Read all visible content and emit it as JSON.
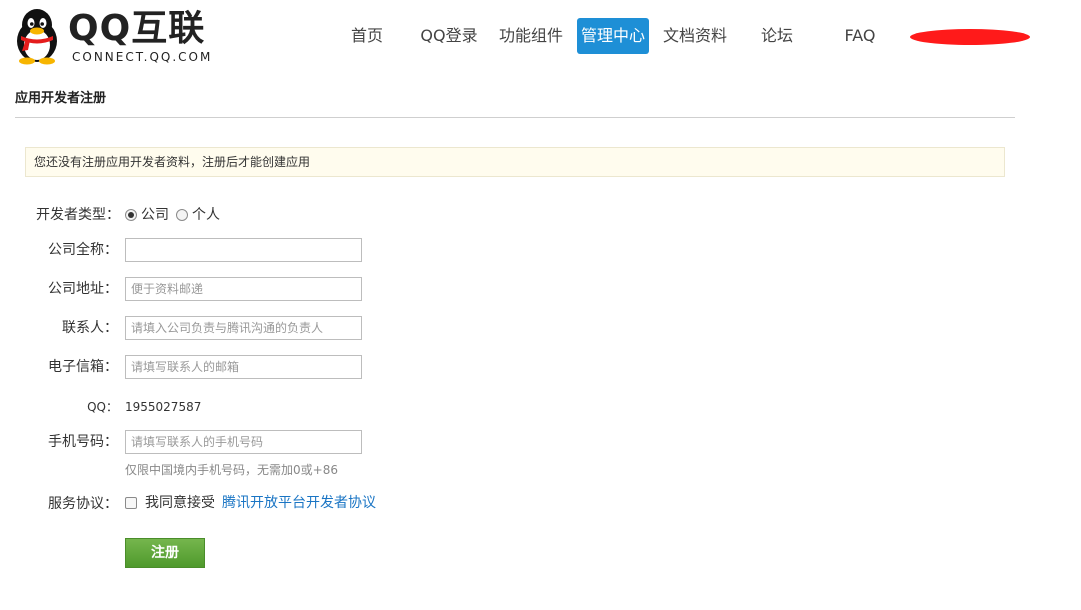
{
  "header": {
    "logo_title": "QQ互联",
    "logo_subtitle": "CONNECT.QQ.COM",
    "logo_icon": "qq-penguin-icon",
    "nav": [
      {
        "label": "首页",
        "active": false
      },
      {
        "label": "QQ登录",
        "active": false
      },
      {
        "label": "功能组件",
        "active": false
      },
      {
        "label": "管理中心",
        "active": true
      },
      {
        "label": "文档资料",
        "active": false
      },
      {
        "label": "论坛",
        "active": false
      },
      {
        "label": "FAQ",
        "active": false
      }
    ],
    "active_color": "#1e8fd6"
  },
  "page": {
    "title": "应用开发者注册",
    "notice": "您还没有注册应用开发者资料，注册后才能创建应用"
  },
  "form": {
    "developer_type": {
      "label": "开发者类型：",
      "options": [
        {
          "label": "公司",
          "checked": true
        },
        {
          "label": "个人",
          "checked": false
        }
      ]
    },
    "company_name": {
      "label": "公司全称：",
      "value": "",
      "placeholder": ""
    },
    "company_address": {
      "label": "公司地址：",
      "value": "",
      "placeholder": "便于资料邮递"
    },
    "contact": {
      "label": "联系人：",
      "value": "",
      "placeholder": "请填入公司负责与腾讯沟通的负责人"
    },
    "email": {
      "label": "电子信箱：",
      "value": "",
      "placeholder": "请填写联系人的邮箱"
    },
    "qq": {
      "label": "QQ：",
      "value": "1955027587"
    },
    "phone": {
      "label": "手机号码：",
      "value": "",
      "placeholder": "请填写联系人的手机号码",
      "hint": "仅限中国境内手机号码，无需加0或+86"
    },
    "agreement": {
      "label": "服务协议：",
      "checkbox_text": "我同意接受",
      "link_text": "腾讯开放平台开发者协议",
      "checked": false
    },
    "submit_label": "注册",
    "submit_color": "#5ea637"
  }
}
